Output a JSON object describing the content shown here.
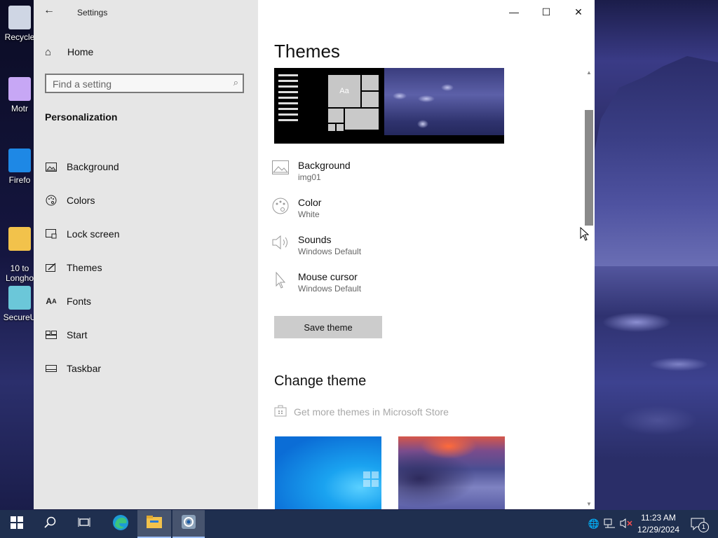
{
  "desktop": {
    "icons": [
      {
        "label": "Recycle",
        "color": "#d9dee8"
      },
      {
        "label": "Motr",
        "color": "#c9a9ff"
      },
      {
        "label": "Firefo",
        "color": "#1e88e5"
      },
      {
        "label": "10 to\nLongho",
        "color": "#f2c24b"
      },
      {
        "label": "SecureU",
        "color": "#6bc7d9"
      }
    ]
  },
  "window": {
    "title": "Settings",
    "back_icon": "back-arrow-icon",
    "controls": {
      "minimize": "—",
      "maximize": "☐",
      "close": "✕"
    }
  },
  "sidebar": {
    "home_label": "Home",
    "search_placeholder": "Find a setting",
    "section_label": "Personalization",
    "items": [
      {
        "label": "Background",
        "icon": "image-icon"
      },
      {
        "label": "Colors",
        "icon": "palette-icon"
      },
      {
        "label": "Lock screen",
        "icon": "lock-screen-icon"
      },
      {
        "label": "Themes",
        "icon": "themes-icon"
      },
      {
        "label": "Fonts",
        "icon": "fonts-icon"
      },
      {
        "label": "Start",
        "icon": "start-icon"
      },
      {
        "label": "Taskbar",
        "icon": "taskbar-icon"
      }
    ]
  },
  "main": {
    "title": "Themes",
    "properties": [
      {
        "label": "Background",
        "value": "img01",
        "icon": "image-icon"
      },
      {
        "label": "Color",
        "value": "White",
        "icon": "palette-icon"
      },
      {
        "label": "Sounds",
        "value": "Windows Default",
        "icon": "speaker-icon"
      },
      {
        "label": "Mouse cursor",
        "value": "Windows Default",
        "icon": "cursor-icon"
      }
    ],
    "save_button": "Save theme",
    "change_theme_title": "Change theme",
    "store_link": "Get more themes in Microsoft Store",
    "preview_tile_label": "Aa"
  },
  "taskbar": {
    "time": "11:23 AM",
    "date": "12/29/2024",
    "notification_count": "1",
    "accent": "#1f2f4f"
  }
}
